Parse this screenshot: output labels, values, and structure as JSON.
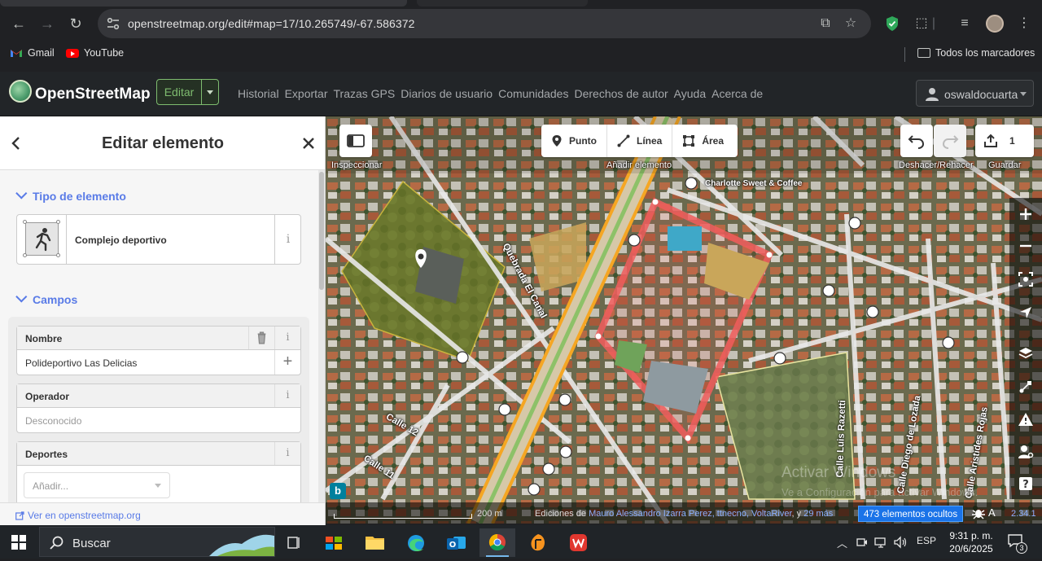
{
  "browser": {
    "url": "openstreetmap.org/edit#map=17/10.265749/-67.586372",
    "bookmarks": [
      {
        "label": "Gmail",
        "icon": "gmail-icon"
      },
      {
        "label": "YouTube",
        "icon": "youtube-icon"
      }
    ],
    "all_bookmarks_label": "Todos los marcadores"
  },
  "osm": {
    "site_title": "OpenStreetMap",
    "edit_label": "Editar",
    "nav": [
      "Historial",
      "Exportar",
      "Trazas GPS",
      "Diarios de usuario",
      "Comunidades",
      "Derechos de autor",
      "Ayuda",
      "Acerca de"
    ],
    "username": "oswaldocuarta"
  },
  "sidebar": {
    "title": "Editar elemento",
    "type_section": "Tipo de elemento",
    "preset_name": "Complejo deportivo",
    "fields_section": "Campos",
    "fields": [
      {
        "label": "Nombre",
        "value": "Polideportivo Las Delicias"
      },
      {
        "label": "Operador",
        "placeholder": "Desconocido"
      },
      {
        "label": "Deportes",
        "placeholder": "Añadir..."
      }
    ],
    "info_glyph": "i",
    "footer_link": "Ver en openstreetmap.org"
  },
  "map": {
    "inspect_label": "Inspeccionar",
    "add_feature_label": "Añadir elemento",
    "modes": [
      {
        "label": "Punto",
        "icon": "point-icon"
      },
      {
        "label": "Línea",
        "icon": "line-icon"
      },
      {
        "label": "Área",
        "icon": "area-icon"
      }
    ],
    "undo_redo_label": "Deshacer/Rehacer",
    "save_label": "Guardar",
    "save_count": "1",
    "poi_label": "Charlotte Sweet & Coffee",
    "street_labels": [
      "Quebrada El Canal",
      "Calle 12",
      "Calle 11",
      "Calle Luis Razetti",
      "Calle Diego de Lozada",
      "Calle Aristides Rojas"
    ],
    "scale_text": "200 m",
    "attribution_prefix": "Ediciones de",
    "attribution_users": "Mauro Alessandro Izarra Perez, ttnecno, VoltaRiver",
    "attribution_and": ", y",
    "attribution_more": "29 más",
    "hidden_elements": "473 elementos ocultos",
    "version": "2.34.1",
    "watermark_title": "Activar Windows",
    "watermark_sub": "Ve a Configuración para activar Windows."
  },
  "taskbar": {
    "search_label": "Buscar",
    "language": "ESP",
    "time": "9:31 p. m.",
    "date": "20/6/2025",
    "notification_count": "3"
  },
  "colors": {
    "osm_green": "#7ebc6f",
    "id_blue": "#597be7",
    "selected_area": "#f15d5d",
    "hidden_badge": "#1a73e8"
  }
}
